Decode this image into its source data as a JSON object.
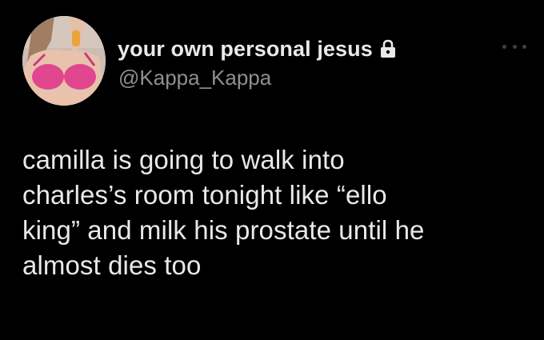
{
  "tweet": {
    "display_name": "your own personal jesus",
    "handle": "@Kappa_Kappa",
    "protected_icon": "lock-icon",
    "more_icon": "ellipsis-icon",
    "text": "camilla is going to walk into\ncharles’s room tonight like “ello\nking” and milk his prostate until he\nalmost dies too"
  },
  "colors": {
    "background": "#000000",
    "primary_text": "#e7e9ea",
    "secondary_text": "#8b9094",
    "avatar_accent": "#e0478f"
  }
}
